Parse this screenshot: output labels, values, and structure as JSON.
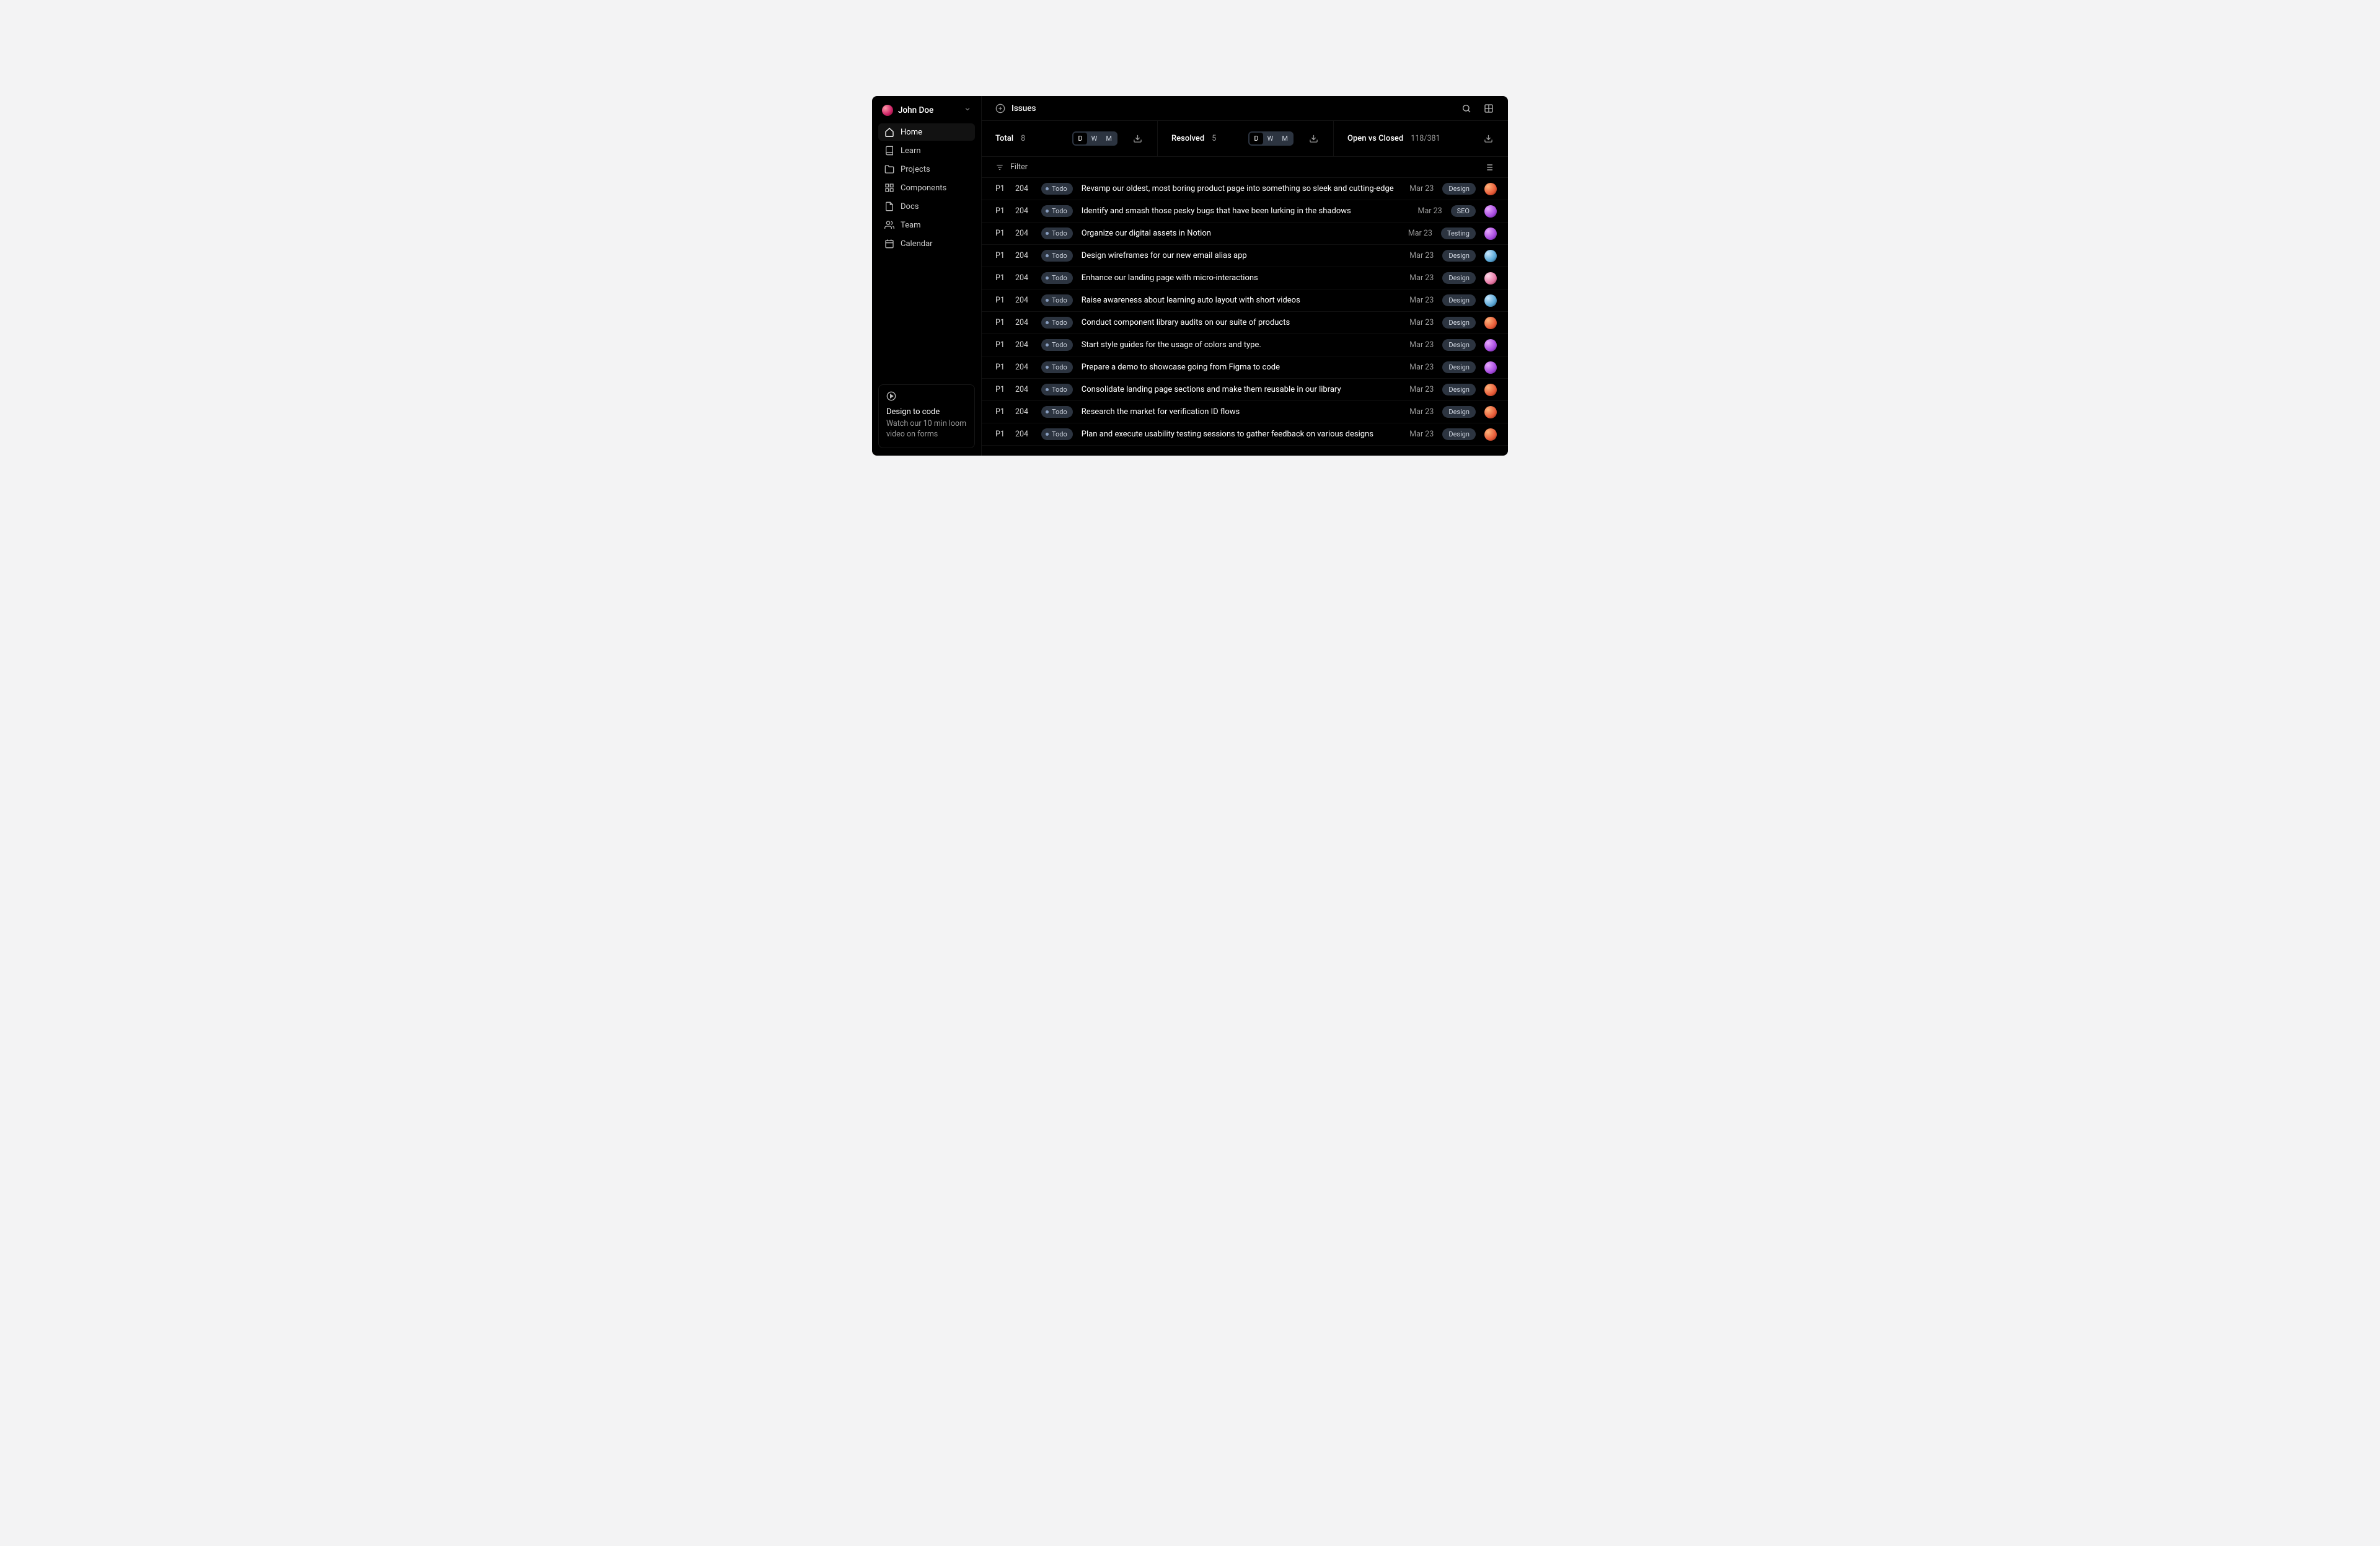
{
  "user": {
    "name": "John Doe"
  },
  "sidebar": {
    "items": [
      {
        "label": "Home",
        "icon": "home",
        "active": true
      },
      {
        "label": "Learn",
        "icon": "book",
        "active": false
      },
      {
        "label": "Projects",
        "icon": "folder",
        "active": false
      },
      {
        "label": "Components",
        "icon": "grid",
        "active": false
      },
      {
        "label": "Docs",
        "icon": "file",
        "active": false
      },
      {
        "label": "Team",
        "icon": "users",
        "active": false
      },
      {
        "label": "Calendar",
        "icon": "calendar",
        "active": false
      }
    ]
  },
  "promo": {
    "title": "Design to code",
    "body": "Watch our 10 min loom video on forms"
  },
  "header": {
    "title": "Issues"
  },
  "stats": [
    {
      "label": "Total",
      "value": "8",
      "segmented": [
        "D",
        "W",
        "M"
      ],
      "active_seg": "D",
      "has_download": true
    },
    {
      "label": "Resolved",
      "value": "5",
      "segmented": [
        "D",
        "W",
        "M"
      ],
      "active_seg": "D",
      "has_download": true
    },
    {
      "label": "Open vs Closed",
      "value": "118/381",
      "segmented": null,
      "active_seg": null,
      "has_download": true
    }
  ],
  "filter": {
    "label": "Filter"
  },
  "issues": [
    {
      "priority": "P1",
      "num": "204",
      "status": "Todo",
      "title": "Revamp our oldest, most boring product page into something so sleek and cutting-edge",
      "date": "Mar 23",
      "tag": "Design",
      "avatar": "av1"
    },
    {
      "priority": "P1",
      "num": "204",
      "status": "Todo",
      "title": "Identify and smash those pesky bugs that have been lurking in the shadows",
      "date": "Mar 23",
      "tag": "SEO",
      "avatar": "av2"
    },
    {
      "priority": "P1",
      "num": "204",
      "status": "Todo",
      "title": "Organize our digital assets in Notion",
      "date": "Mar 23",
      "tag": "Testing",
      "avatar": "av2"
    },
    {
      "priority": "P1",
      "num": "204",
      "status": "Todo",
      "title": "Design wireframes for our new email alias app",
      "date": "Mar 23",
      "tag": "Design",
      "avatar": "av3"
    },
    {
      "priority": "P1",
      "num": "204",
      "status": "Todo",
      "title": "Enhance our landing page with micro-interactions",
      "date": "Mar 23",
      "tag": "Design",
      "avatar": "av4"
    },
    {
      "priority": "P1",
      "num": "204",
      "status": "Todo",
      "title": "Raise awareness about learning auto layout with short videos",
      "date": "Mar 23",
      "tag": "Design",
      "avatar": "av3"
    },
    {
      "priority": "P1",
      "num": "204",
      "status": "Todo",
      "title": "Conduct component library audits on our suite of products",
      "date": "Mar 23",
      "tag": "Design",
      "avatar": "av1"
    },
    {
      "priority": "P1",
      "num": "204",
      "status": "Todo",
      "title": "Start style guides for the usage of colors and type.",
      "date": "Mar 23",
      "tag": "Design",
      "avatar": "av2"
    },
    {
      "priority": "P1",
      "num": "204",
      "status": "Todo",
      "title": "Prepare a demo to showcase going from Figma to code",
      "date": "Mar 23",
      "tag": "Design",
      "avatar": "av2"
    },
    {
      "priority": "P1",
      "num": "204",
      "status": "Todo",
      "title": "Consolidate landing page sections and make them reusable in our library",
      "date": "Mar 23",
      "tag": "Design",
      "avatar": "av1"
    },
    {
      "priority": "P1",
      "num": "204",
      "status": "Todo",
      "title": "Research the market for verification ID flows",
      "date": "Mar 23",
      "tag": "Design",
      "avatar": "av1"
    },
    {
      "priority": "P1",
      "num": "204",
      "status": "Todo",
      "title": "Plan and execute usability testing sessions to gather feedback on various designs",
      "date": "Mar 23",
      "tag": "Design",
      "avatar": "av1"
    }
  ]
}
